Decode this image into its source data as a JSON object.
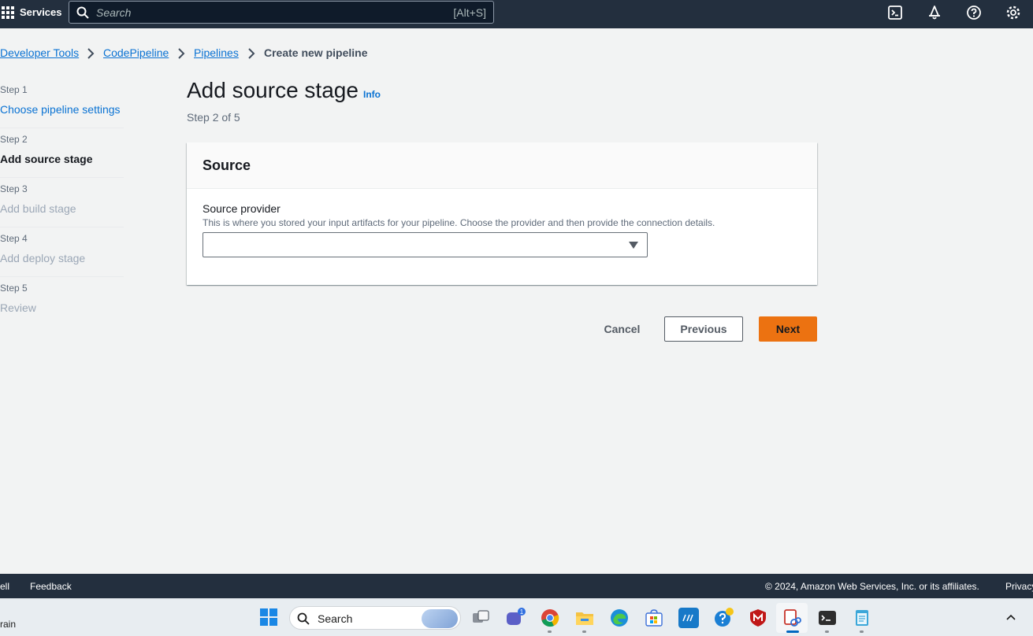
{
  "topnav": {
    "services_label": "Services",
    "search_placeholder": "Search",
    "search_shortcut": "[Alt+S]",
    "icons": [
      "cloudshell-icon",
      "notifications-icon",
      "help-icon",
      "settings-icon"
    ]
  },
  "breadcrumb": {
    "items": [
      "Developer Tools",
      "CodePipeline",
      "Pipelines"
    ],
    "current": "Create new pipeline"
  },
  "steps": [
    {
      "num": "Step 1",
      "title": "Choose pipeline settings",
      "state": "link"
    },
    {
      "num": "Step 2",
      "title": "Add source stage",
      "state": "current"
    },
    {
      "num": "Step 3",
      "title": "Add build stage",
      "state": "disabled"
    },
    {
      "num": "Step 4",
      "title": "Add deploy stage",
      "state": "disabled"
    },
    {
      "num": "Step 5",
      "title": "Review",
      "state": "disabled"
    }
  ],
  "main": {
    "title": "Add source stage",
    "info_link": "Info",
    "step_indicator": "Step 2 of 5",
    "container": {
      "title": "Source",
      "field_label": "Source provider",
      "field_description": "This is where you stored your input artifacts for your pipeline. Choose the provider and then provide the connection details.",
      "select_value": ""
    },
    "actions": {
      "cancel": "Cancel",
      "previous": "Previous",
      "next": "Next"
    }
  },
  "footer": {
    "cloudshell": "ell",
    "feedback": "Feedback",
    "copyright": "© 2024, Amazon Web Services, Inc. or its affiliates.",
    "privacy": "Privacy"
  },
  "taskbar": {
    "weather_text": "rain",
    "search_label": "Search",
    "teams_badge": "1"
  },
  "colors": {
    "nav_bg": "#232f3e",
    "link": "#0972d3",
    "primary_button": "#ec7211",
    "page_bg": "#f2f3f3"
  }
}
